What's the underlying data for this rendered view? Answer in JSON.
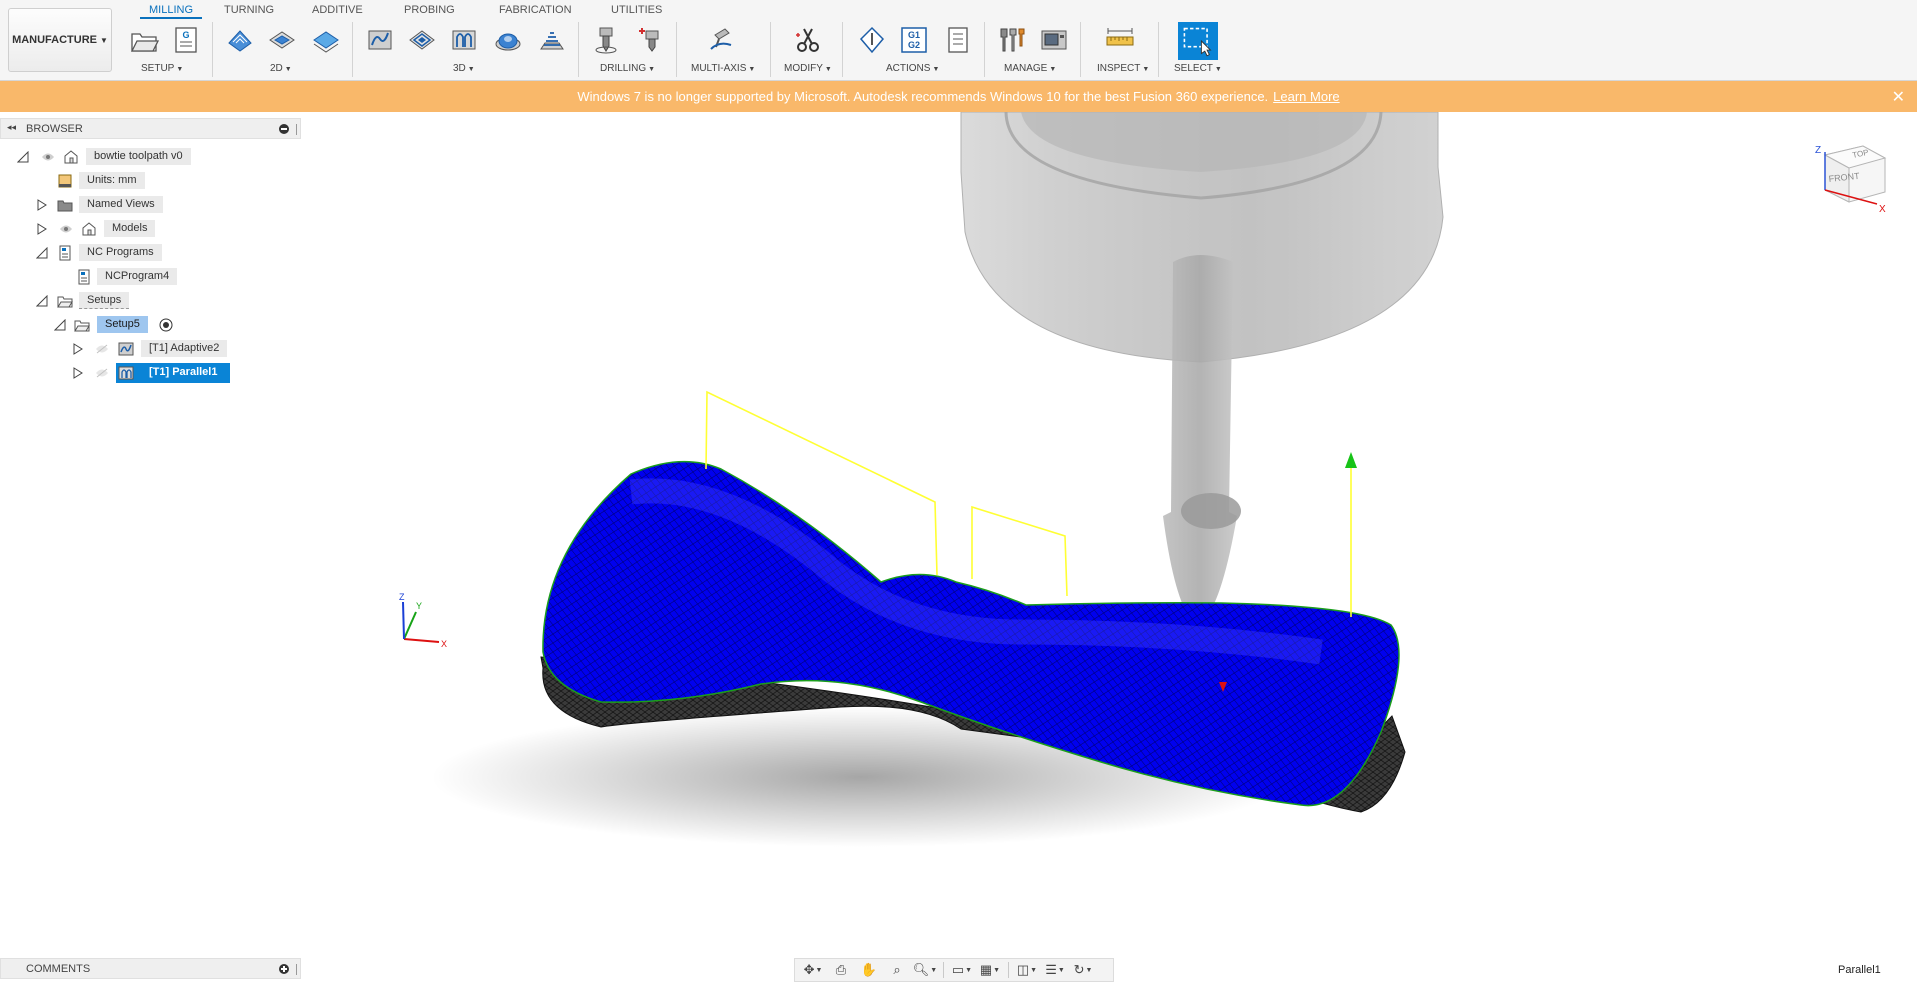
{
  "toolbar": {
    "workspace": "MANUFACTURE",
    "tabs": [
      "MILLING",
      "TURNING",
      "ADDITIVE",
      "PROBING",
      "FABRICATION",
      "UTILITIES"
    ],
    "groups": {
      "setup": "SETUP",
      "twod": "2D",
      "threed": "3D",
      "drilling": "DRILLING",
      "multiaxis": "MULTI-AXIS",
      "modify": "MODIFY",
      "actions": "ACTIONS",
      "manage": "MANAGE",
      "inspect": "INSPECT",
      "select": "SELECT"
    },
    "nc_icon_letter": "G",
    "g1g2_top": "G1",
    "g1g2_bottom": "G2"
  },
  "banner": {
    "message": "Windows 7 is no longer supported by Microsoft. Autodesk recommends Windows 10 for the best Fusion 360 experience.",
    "link": "Learn More",
    "color": "#f9b86a"
  },
  "browser": {
    "title": "BROWSER",
    "items": [
      {
        "label": "bowtie toolpath v0",
        "icon": "document-icon"
      },
      {
        "label": "Units: mm",
        "icon": "units-icon"
      },
      {
        "label": "Named Views",
        "icon": "folder-icon"
      },
      {
        "label": "Models",
        "icon": "models-icon"
      },
      {
        "label": "NC Programs",
        "icon": "nc-programs-icon"
      },
      {
        "label": "NCProgram4",
        "icon": "nc-program-icon"
      },
      {
        "label": "Setups",
        "icon": "setups-icon"
      },
      {
        "label": "Setup5",
        "icon": "setup-icon"
      },
      {
        "label": "[T1] Adaptive2",
        "icon": "adaptive-op-icon"
      },
      {
        "label": "[T1] Parallel1",
        "icon": "parallel-op-icon"
      }
    ]
  },
  "comments": {
    "title": "COMMENTS"
  },
  "viewcube": {
    "top": "TOP",
    "front": "FRONT",
    "z": "Z",
    "x": "X"
  },
  "triad": {
    "x": "X",
    "y": "Y",
    "z": "Z"
  },
  "status": {
    "selection": "Parallel1"
  },
  "colors": {
    "accent": "#0a71bd",
    "selection": "#0a84d6",
    "toolpath": "#0000f0",
    "retract": "#ffff33",
    "banner": "#f9b86a"
  }
}
